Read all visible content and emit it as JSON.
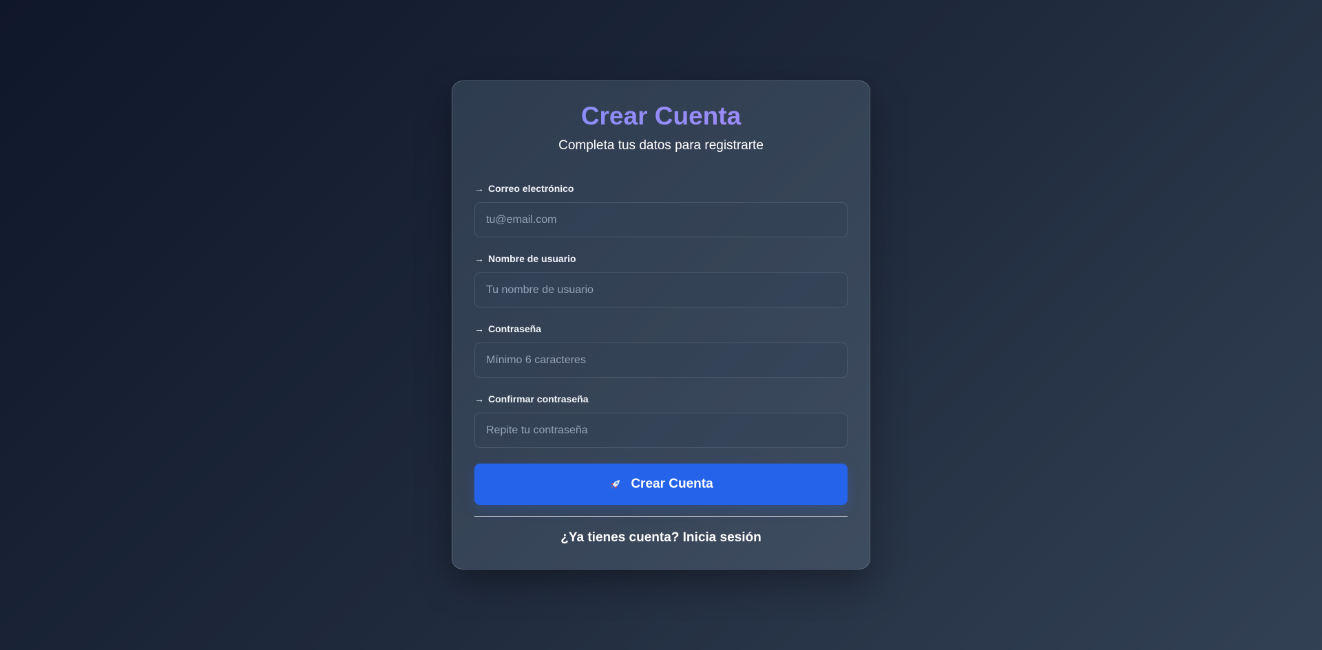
{
  "form": {
    "title": "Crear Cuenta",
    "subtitle": "Completa tus datos para registrarte",
    "fields": [
      {
        "label": "Correo electrónico",
        "placeholder": "tu@email.com",
        "value": ""
      },
      {
        "label": "Nombre de usuario",
        "placeholder": "Tu nombre de usuario",
        "value": ""
      },
      {
        "label": "Contraseña",
        "placeholder": "Mínimo 6 caracteres",
        "value": ""
      },
      {
        "label": "Confirmar contraseña",
        "placeholder": "Repite tu contraseña",
        "value": ""
      }
    ],
    "field_arrow": "→",
    "submit_label": "Crear Cuenta",
    "submit_icon": "rocket-icon",
    "login_prompt": "¿Ya tienes cuenta? Inicia sesión"
  },
  "colors": {
    "accent": "#2563eb",
    "title_gradient_start": "#818cf8",
    "title_gradient_end": "#a78bfa",
    "background_start": "#0f172a",
    "background_end": "#334155"
  }
}
